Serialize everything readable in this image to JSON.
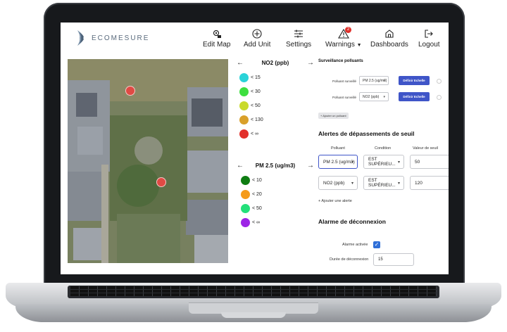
{
  "app": {
    "brand": "ECOMESURE"
  },
  "nav": {
    "edit_map": "Edit Map",
    "add_unit": "Add Unit",
    "settings": "Settings",
    "warnings": "Warnings",
    "warnings_count": "2",
    "dashboards": "Dashboards",
    "logout": "Logout"
  },
  "legend_no2": {
    "title": "NO2 (ppb)",
    "items": [
      {
        "label": "< 15",
        "color": "#2ad3d8"
      },
      {
        "label": "< 30",
        "color": "#3ddf3f"
      },
      {
        "label": "< 50",
        "color": "#c9da2b"
      },
      {
        "label": "< 130",
        "color": "#d9a02a"
      },
      {
        "label": "< ∞",
        "color": "#e2302b"
      }
    ]
  },
  "legend_pm25": {
    "title": "PM 2.5 (ug/m3)",
    "items": [
      {
        "label": "< 10",
        "color": "#0f7d12"
      },
      {
        "label": "< 20",
        "color": "#f59b1a"
      },
      {
        "label": "< 50",
        "color": "#23e07a"
      },
      {
        "label": "< ∞",
        "color": "#9d24e6"
      }
    ]
  },
  "surveillance": {
    "title": "Surveillance polluants",
    "rows": [
      {
        "label": "Polluant surveillé",
        "value": "PM 2.5 (ug/m3)",
        "button": "Définir Echelle"
      },
      {
        "label": "Polluant surveillé",
        "value": "NO2 (ppb)",
        "button": "Définir Echelle"
      }
    ],
    "add": "+ Ajouter un polluant"
  },
  "alerts": {
    "title": "Alertes de dépassements de seuil",
    "headers": {
      "pollutant": "Polluant",
      "condition": "Condition",
      "threshold": "Valeur de seuil"
    },
    "rows": [
      {
        "pollutant": "PM 2.5 (ug/m3)",
        "condition": "EST SUPÉRIEU...",
        "threshold": "50"
      },
      {
        "pollutant": "NO2 (ppb)",
        "condition": "EST SUPÉRIEU...",
        "threshold": "120"
      }
    ],
    "add": "+ Ajouter une alerte"
  },
  "disconnect": {
    "title": "Alarme de déconnexion",
    "alarm_label": "Alarme activée",
    "duration_label": "Durée de déconnexion",
    "duration_value": "15"
  },
  "colors": {
    "accent": "#3f55c8",
    "marker": "#e04a44"
  }
}
